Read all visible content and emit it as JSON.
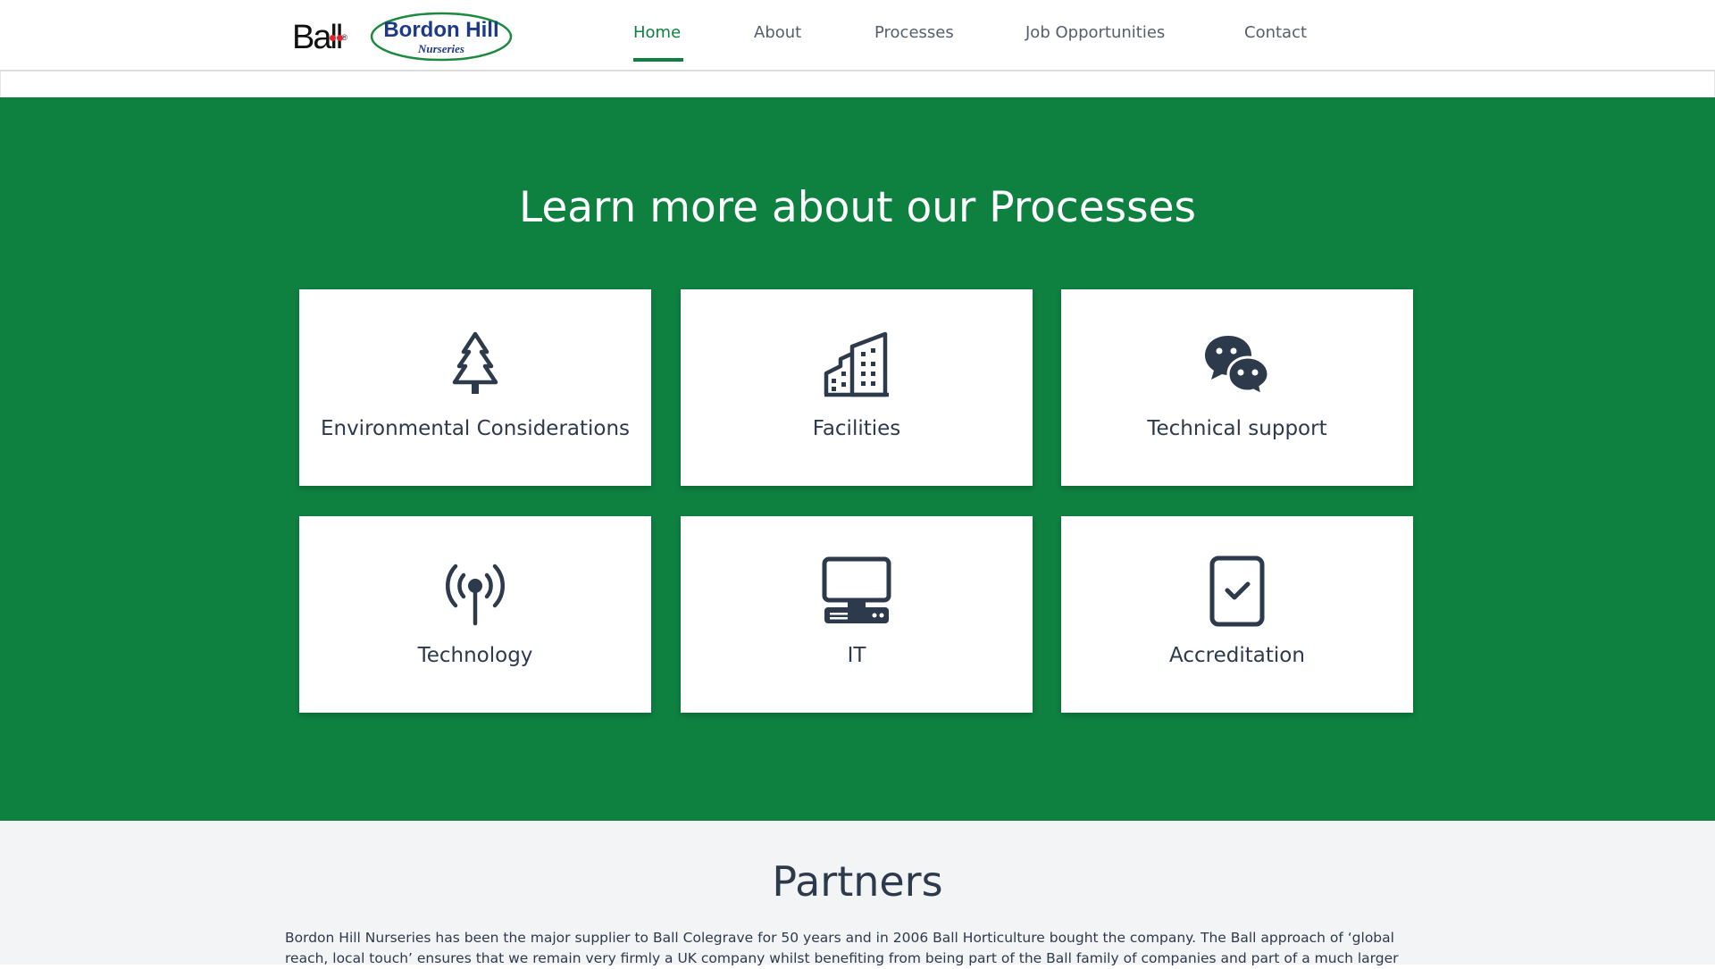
{
  "header": {
    "ball_logo_text": "Ball",
    "bordon_logo": {
      "name": "Bordon Hill",
      "sub": "Nurseries"
    },
    "nav": [
      {
        "label": "Home",
        "active": true
      },
      {
        "label": "About",
        "active": false
      },
      {
        "label": "Processes",
        "active": false
      },
      {
        "label": "Job Opportunities",
        "active": false
      },
      {
        "label": "Contact",
        "active": false
      }
    ]
  },
  "processes": {
    "title": "Learn more about our Processes",
    "cards": [
      {
        "label": "Environmental Considerations",
        "icon": "tree-icon"
      },
      {
        "label": "Facilities",
        "icon": "building-icon"
      },
      {
        "label": "Technical support",
        "icon": "chat-bubbles-icon"
      },
      {
        "label": "Technology",
        "icon": "antenna-signal-icon"
      },
      {
        "label": "IT",
        "icon": "computer-icon"
      },
      {
        "label": "Accreditation",
        "icon": "clipboard-check-icon"
      }
    ]
  },
  "partners": {
    "title": "Partners",
    "text": "Bordon Hill Nurseries has been the major supplier to Ball Colegrave for 50 years and in 2006 Ball Horticulture bought the company. The Ball approach of ‘global reach, local touch’ ensures that we remain very firmly a UK company whilst benefiting from being part of the Ball family of companies and part of a much larger"
  },
  "colors": {
    "brand_green": "#0e8040",
    "text_dark": "#2d3a4b",
    "logo_blue": "#1d3a8a",
    "ball_red": "#e0242d"
  }
}
